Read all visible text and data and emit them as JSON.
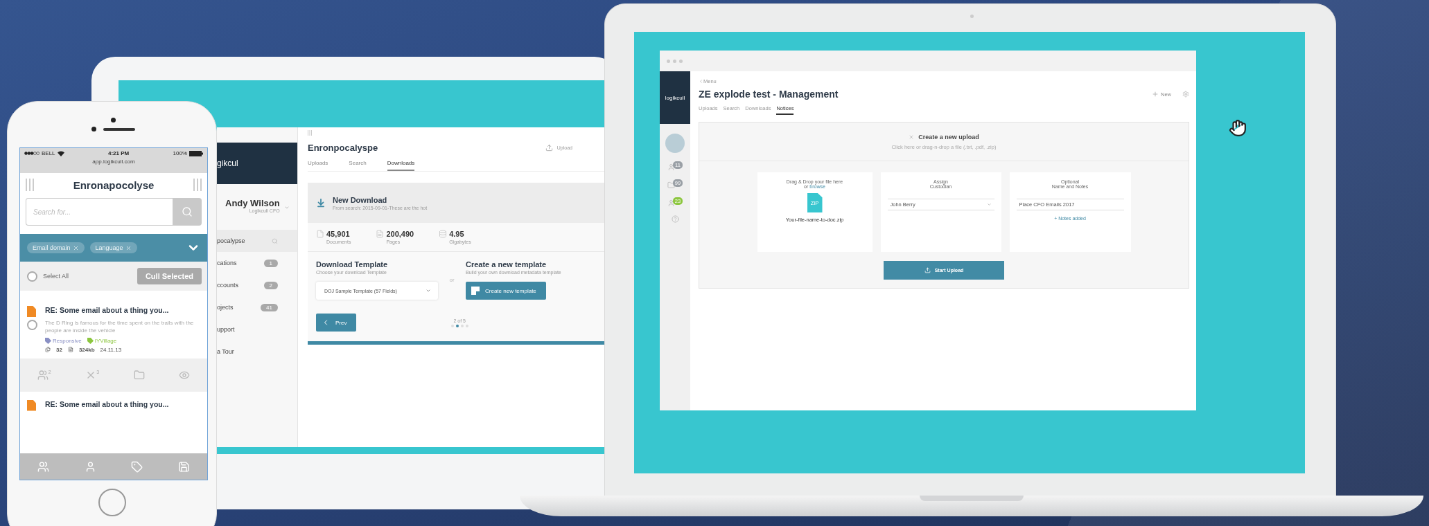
{
  "phone": {
    "status_bar": {
      "carrier": "BELL",
      "time": "4:21 PM",
      "battery": "100%"
    },
    "url": "app.logikcull.com",
    "title": "Enronapocolyse",
    "search": {
      "placeholder": "Search for..."
    },
    "filters": [
      {
        "label": "Email domain"
      },
      {
        "label": "Language"
      }
    ],
    "select_all": {
      "label": "Select All",
      "checked": false
    },
    "cull_button": "Cull Selected",
    "emails": [
      {
        "subject": "RE: Some email about a thing you...",
        "snippet": "The D Ring is famous for the time spent on the trails with the people are inside the vehicle",
        "checked": false,
        "tags": [
          {
            "label": "Responsive",
            "color": "#8a90c4"
          },
          {
            "label": "IYVillage",
            "color": "#8cc63f"
          }
        ],
        "count": "32",
        "size": "324kb",
        "date": "24.11.13"
      },
      {
        "subject": "RE: Some email about a thing you..."
      }
    ],
    "email_actions": [
      {
        "kind": "people",
        "badge": "2"
      },
      {
        "kind": "cross",
        "badge": "3"
      },
      {
        "kind": "folder"
      },
      {
        "kind": "eye"
      }
    ],
    "bottom_tabs": [
      {
        "kind": "people"
      },
      {
        "kind": "person"
      },
      {
        "kind": "tag"
      },
      {
        "kind": "save"
      }
    ]
  },
  "tablet": {
    "sidebar": {
      "logo": "gikcul",
      "user": {
        "name": "Andy Wilson",
        "role": "Logikcull CFO"
      },
      "nav": [
        {
          "label": "pocalypse",
          "selected": true,
          "kind": "search"
        },
        {
          "label": "cations",
          "badge": "1",
          "selected": false
        },
        {
          "label": "ccounts",
          "badge": "2",
          "selected": false
        },
        {
          "label": "ojects",
          "badge": "41",
          "selected": false
        },
        {
          "label": "upport",
          "selected": false
        },
        {
          "label": "a Tour",
          "selected": false
        }
      ]
    },
    "title": "Enronpocalyspe",
    "action": "Upload",
    "tabs": [
      {
        "label": "Uploads",
        "selected": false
      },
      {
        "label": "Search",
        "selected": false
      },
      {
        "label": "Downloads",
        "selected": true
      }
    ],
    "download": {
      "title": "New Download",
      "subtitle": "From search: 2015-09-01-These are the hot"
    },
    "stats": [
      {
        "kind": "documents",
        "value": "45,901",
        "label": "Documents"
      },
      {
        "kind": "pages",
        "value": "200,490",
        "label": "Pages"
      },
      {
        "kind": "storage",
        "value": "4.95",
        "label": "Gigabytes"
      }
    ],
    "template": {
      "title": "Download Template",
      "subtitle": "Choose your download Template",
      "value": "DOJ Sample Template (57 Fields)"
    },
    "separator": "or",
    "create": {
      "title": "Create a new template",
      "subtitle": "Build your own download metadata template",
      "button": "Create new template"
    },
    "pager": {
      "prev": "Prev",
      "page": "2 of 5",
      "dots": [
        {
          "selected": false
        },
        {
          "selected": true
        },
        {
          "selected": false
        },
        {
          "selected": false
        }
      ]
    }
  },
  "laptop": {
    "breadcrumb": "Menu",
    "logo": "logikcull",
    "title": "ZE explode test - Management",
    "new_button": "New",
    "tabs": [
      {
        "label": "Uploads",
        "selected": false
      },
      {
        "label": "Search",
        "selected": false
      },
      {
        "label": "Downloads",
        "selected": false
      },
      {
        "label": "Notices",
        "selected": true
      }
    ],
    "sidebar_badges": [
      {
        "kind": "person",
        "count": "11",
        "color": "#9aa0a6"
      },
      {
        "kind": "folder",
        "count": "99",
        "color": "#9aa0a6"
      },
      {
        "kind": "person",
        "count": "23",
        "color": "#8cc63f"
      }
    ],
    "upload": {
      "title": "Create a new upload",
      "hint": "Click here or drag-n-drop a file (.txt, .pdf, .zip)",
      "drop": {
        "text": "Drag & Drop your file here",
        "prefix": "or",
        "link": "browse",
        "file_label": "ZIP",
        "file_name": "Your-file-name-to-doc.zip"
      },
      "custodian": {
        "title": "Assign",
        "subtitle": "Custodian",
        "value": "John Berry"
      },
      "notes": {
        "title": "Optional",
        "subtitle": "Name and Notes",
        "value": "Place CFO Emails 2017",
        "link": "+ Notes added"
      },
      "button": "Start Upload"
    }
  }
}
